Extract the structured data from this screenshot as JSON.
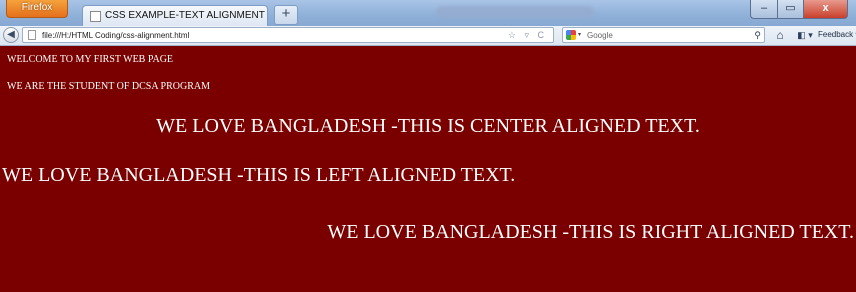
{
  "browser": {
    "menu_button": "Firefox",
    "tab_title": "CSS EXAMPLE-TEXT ALIGNMENT",
    "new_tab": "+",
    "window_controls": {
      "minimize": "–",
      "maximize": "▭",
      "close": "x"
    }
  },
  "navbar": {
    "url": "file:///H:/HTML Coding/css-alignment.html",
    "url_icons": "☆ ▿ C",
    "search_engine_icon": "google-icon",
    "search_placeholder": "Google",
    "search_button": "⚲",
    "home": "⌂",
    "bookmarks": "◧ ▾",
    "feedback": "Feedback ▾"
  },
  "page": {
    "background_color": "#7a0000",
    "text_color": "#ffffff",
    "welcome": "WELCOME TO MY FIRST WEB PAGE",
    "student": "WE ARE THE STUDENT OF DCSA PROGRAM",
    "center_text": "WE LOVE BANGLADESH -THIS IS CENTER ALIGNED TEXT.",
    "left_text": "WE LOVE BANGLADESH -THIS IS LEFT ALIGNED TEXT.",
    "right_text": "WE LOVE BANGLADESH -THIS IS RIGHT ALIGNED TEXT."
  }
}
